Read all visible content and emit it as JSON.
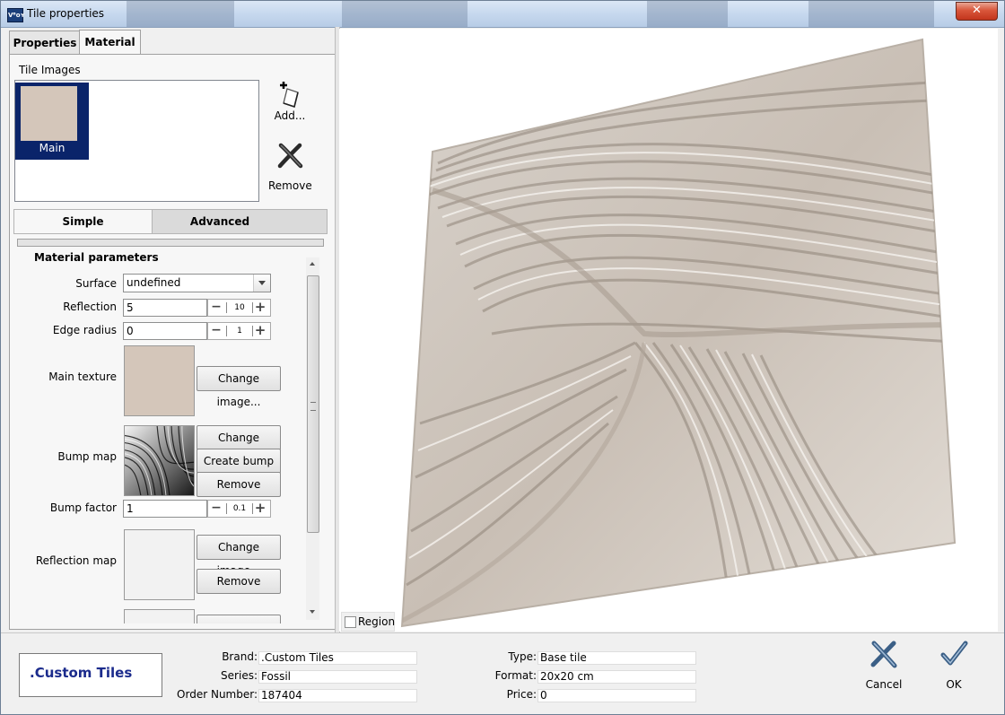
{
  "window": {
    "title": "Tile properties",
    "app_icon_text": "Vᴮᴏʏ",
    "close_label": "✕"
  },
  "tabs": [
    {
      "label": "Properties"
    },
    {
      "label": "Material",
      "active": true
    }
  ],
  "tile_images": {
    "label": "Tile Images",
    "items": [
      {
        "name": "Main",
        "color": "#d4c6ba"
      }
    ],
    "add_label": "Add...",
    "remove_label": "Remove"
  },
  "subtabs": [
    {
      "label": "Simple",
      "active": true
    },
    {
      "label": "Advanced"
    }
  ],
  "material": {
    "section_title": "Material parameters",
    "surface": {
      "label": "Surface",
      "value": "undefined"
    },
    "reflection": {
      "label": "Reflection",
      "value": "5",
      "step": "10"
    },
    "edge_radius": {
      "label": "Edge radius",
      "value": "0",
      "step": "1"
    },
    "main_texture": {
      "label": "Main texture",
      "change_label": "Change image...",
      "color": "#d4c6ba"
    },
    "bump_map": {
      "label": "Bump map",
      "change_label": "Change image...",
      "create_label": "Create bump",
      "remove_label": "Remove"
    },
    "bump_factor": {
      "label": "Bump factor",
      "value": "1",
      "step": "0.1"
    },
    "reflection_map": {
      "label": "Reflection map",
      "change_label": "Change image...",
      "remove_label": "Remove"
    }
  },
  "preview": {
    "region_label": "Region",
    "region_checked": false
  },
  "info": {
    "brand_display": ".Custom Tiles",
    "brand": {
      "label": "Brand:",
      "value": ".Custom Tiles"
    },
    "series": {
      "label": "Series:",
      "value": "Fossil"
    },
    "order_number": {
      "label": "Order Number:",
      "value": "187404"
    },
    "type": {
      "label": "Type:",
      "value": "Base tile"
    },
    "format": {
      "label": "Format:",
      "value": "20x20 cm"
    },
    "price": {
      "label": "Price:",
      "value": "0"
    }
  },
  "actions": {
    "cancel_label": "Cancel",
    "ok_label": "OK"
  }
}
